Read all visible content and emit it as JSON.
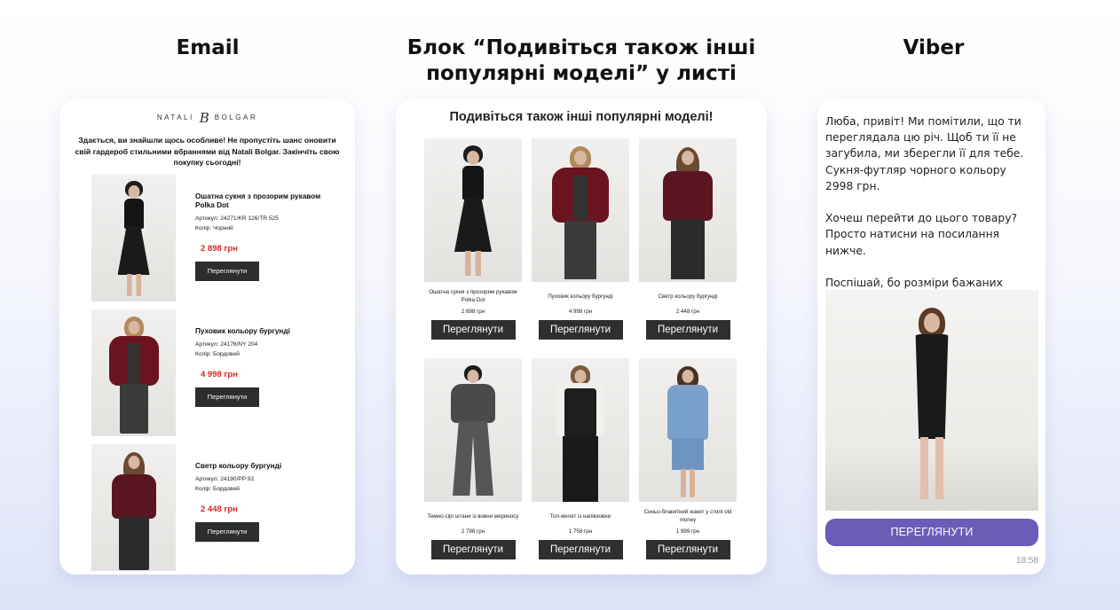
{
  "titles": {
    "email": "Email",
    "grid_line1": "Блок “Подивіться також інші",
    "grid_line2": "популярні моделі” у листі",
    "viber": "Viber"
  },
  "email": {
    "logo_left": "NATALI",
    "logo_mark": "B",
    "logo_right": "BOLGAR",
    "intro": "Здається, ви знайшли щось особливе! Не пропустіть шанс оновити свій гардероб стильними вбраннями від Natali Bolgar. Закінчіть свою покупку сьогодні!",
    "items": [
      {
        "name": "Ошатна сукня з прозорим рукавом Polka Dot",
        "article": "Артикул: 24271/KR 126/TR 525",
        "color": "Колір: Чорний",
        "price": "2 898 грн",
        "button": "Переглянути"
      },
      {
        "name": "Пуховик кольору бургунді",
        "article": "Артикул: 24176/NY 204",
        "color": "Колір: Бордовий",
        "price": "4 998 грн",
        "button": "Переглянути"
      },
      {
        "name": "Светр кольору бургунді",
        "article": "Артикул: 24190/PP 92",
        "color": "Колір: Бордовий",
        "price": "2 448 грн",
        "button": "Переглянути"
      }
    ]
  },
  "grid": {
    "title": "Подивіться також інші популярні моделі!",
    "items": [
      {
        "name": "Ошатна сукня з прозорим рукавом Polka Dot",
        "price": "2 898 грн",
        "button": "Переглянути"
      },
      {
        "name": "Пуховик кольору бургунді",
        "price": "4 998 грн",
        "button": "Переглянути"
      },
      {
        "name": "Светр кольору бургунді",
        "price": "2 448 грн",
        "button": "Переглянути"
      },
      {
        "name": "Темно-сірі штани із вовни мериносу",
        "price": "2 798 грн",
        "button": "Переглянути"
      },
      {
        "name": "Топ-жилет із напівзовни",
        "price": "1 758 грн",
        "button": "Переглянути"
      },
      {
        "name": "Синьо-блакитний жакет у стилі old money",
        "price": "1 999 грн",
        "button": "Переглянути"
      }
    ]
  },
  "viber": {
    "message": "Люба, привіт! Ми помітили, що ти переглядала цю річ. Щоб ти її не загубила, ми зберегли її для тебе. Сукня-футляр чорного кольору 2998 грн.\n\nХочеш перейти до цього товару? Просто натисни на посилання нижче.\n\nПоспішай, бо розміри бажаних позицій закінчуються першими!",
    "button": "ПЕРЕГЛЯНУТИ",
    "time": "18:58"
  },
  "colors": {
    "price_red": "#d42a22",
    "button_dark": "#2d2d2d",
    "viber_purple": "#6c5bb7"
  }
}
